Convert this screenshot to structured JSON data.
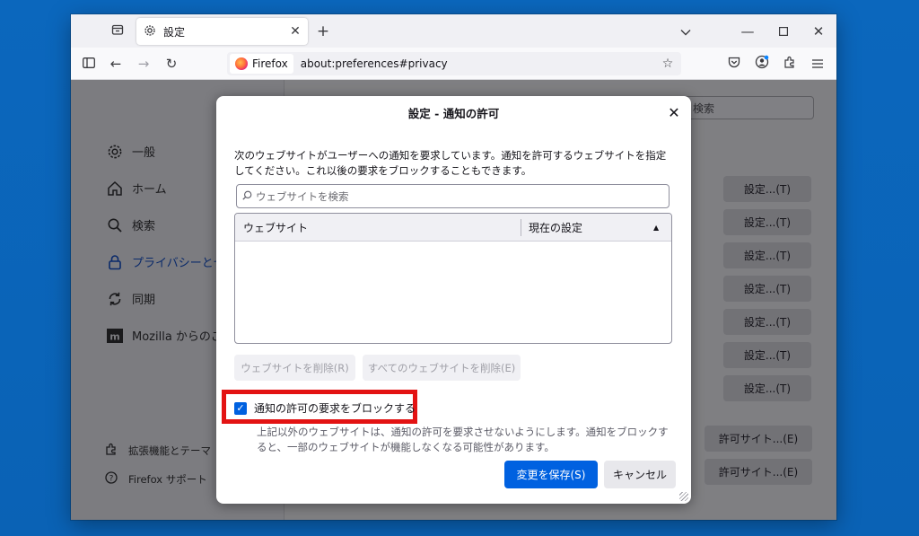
{
  "browser": {
    "tab": {
      "title": "設定"
    },
    "identity_label": "Firefox",
    "url": "about:preferences#privacy"
  },
  "sidebar": {
    "items": [
      {
        "label": "一般",
        "icon": "gear-icon"
      },
      {
        "label": "ホーム",
        "icon": "home-icon"
      },
      {
        "label": "検索",
        "icon": "search-icon"
      },
      {
        "label": "プライバシーとセキ",
        "icon": "lock-icon",
        "selected": true
      },
      {
        "label": "同期",
        "icon": "sync-icon"
      },
      {
        "label": "Mozilla からのご",
        "icon": "mozilla-icon"
      }
    ],
    "bottom_links": [
      {
        "label": "拡張機能とテーマ",
        "icon": "puzzle-icon"
      },
      {
        "label": "Firefox サポート",
        "icon": "help-icon"
      }
    ]
  },
  "background": {
    "find_placeholder": "検索",
    "settings_button": "設定...(T)",
    "exceptions_button": "許可サイト...(E)"
  },
  "dialog": {
    "title": "設定 - 通知の許可",
    "description": "次のウェブサイトがユーザーへの通知を要求しています。通知を許可するウェブサイトを指定してください。これ以後の要求をブロックすることもできます。",
    "search_placeholder": "ウェブサイトを検索",
    "columns": {
      "website": "ウェブサイト",
      "status": "現在の設定"
    },
    "remove_button": "ウェブサイトを削除(R)",
    "remove_all_button": "すべてのウェブサイトを削除(E)",
    "block_checkbox": {
      "label": "通知の許可の要求をブロックする",
      "checked": true
    },
    "block_description": "上記以外のウェブサイトは、通知の許可を要求させないようにします。通知をブロックすると、一部のウェブサイトが機能しなくなる可能性があります。",
    "save_button": "変更を保存(S)",
    "cancel_button": "キャンセル"
  },
  "colors": {
    "accent": "#0061e0",
    "highlight": "#e31313",
    "desktop": "#0a64b8"
  }
}
